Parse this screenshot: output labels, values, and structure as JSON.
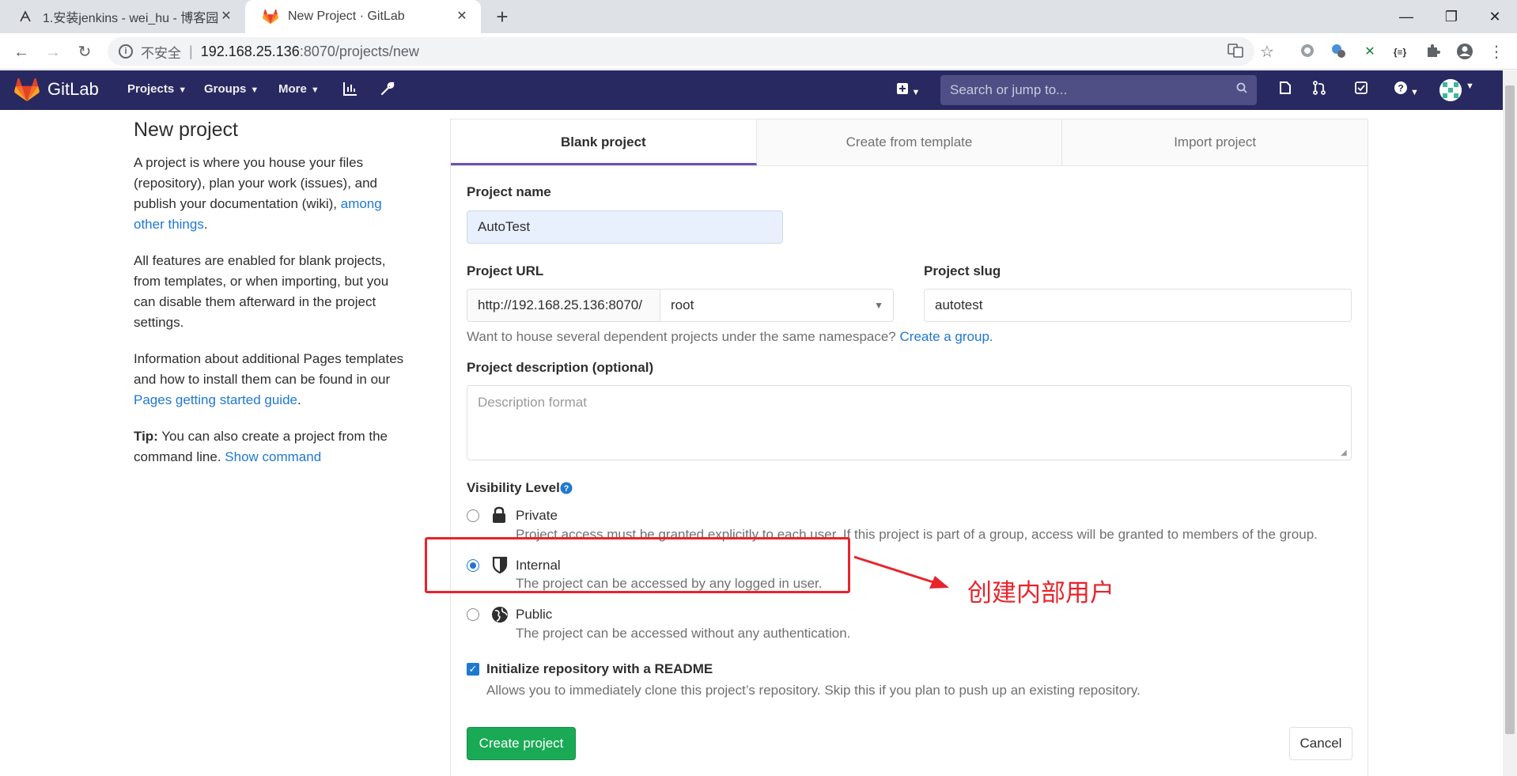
{
  "browser": {
    "tabs": [
      {
        "title": "1.安装jenkins - wei_hu - 博客园",
        "active": false
      },
      {
        "title": "New Project · GitLab",
        "active": true
      }
    ],
    "address": {
      "security_label": "不安全",
      "host": "192.168.25.136",
      "path": ":8070/projects/new"
    }
  },
  "gitlab_nav": {
    "brand": "GitLab",
    "menus": [
      "Projects",
      "Groups",
      "More"
    ],
    "search_placeholder": "Search or jump to..."
  },
  "sidebar": {
    "title": "New project",
    "para1_text": "A project is where you house your files (repository), plan your work (issues), and publish your documentation (wiki), ",
    "para1_link": "among other things",
    "para1_end": ".",
    "para2": "All features are enabled for blank projects, from templates, or when importing, but you can disable them afterward in the project settings.",
    "para3_text": "Information about additional Pages templates and how to install them can be found in our ",
    "para3_link": "Pages getting started guide",
    "para3_end": ".",
    "tip_label": "Tip:",
    "tip_text": " You can also create a project from the command line. ",
    "tip_link": "Show command"
  },
  "form": {
    "tabs": [
      "Blank project",
      "Create from template",
      "Import project"
    ],
    "project_name_label": "Project name",
    "project_name_value": "AutoTest",
    "project_url_label": "Project URL",
    "project_url_prefix": "http://192.168.25.136:8070/",
    "namespace_value": "root",
    "project_slug_label": "Project slug",
    "project_slug_value": "autotest",
    "namespace_hint": "Want to house several dependent projects under the same namespace? ",
    "namespace_hint_link": "Create a group.",
    "description_label": "Project description (optional)",
    "description_placeholder": "Description format",
    "visibility_label": "Visibility Level",
    "visibility_options": [
      {
        "title": "Private",
        "desc": "Project access must be granted explicitly to each user. If this project is part of a group, access will be granted to members of the group.",
        "selected": false
      },
      {
        "title": "Internal",
        "desc": "The project can be accessed by any logged in user.",
        "selected": true
      },
      {
        "title": "Public",
        "desc": "The project can be accessed without any authentication.",
        "selected": false
      }
    ],
    "readme_label": "Initialize repository with a README",
    "readme_checked": true,
    "readme_desc": "Allows you to immediately clone this project’s repository. Skip this if you plan to push up an existing repository.",
    "create_button": "Create project",
    "cancel_button": "Cancel"
  },
  "annotation": {
    "text": "创建内部用户",
    "color": "#e8242b"
  },
  "colors": {
    "nav_bg": "#292961",
    "active_tab_border": "#6b4fbb",
    "link": "#1f78d1",
    "success": "#1aaa55"
  }
}
